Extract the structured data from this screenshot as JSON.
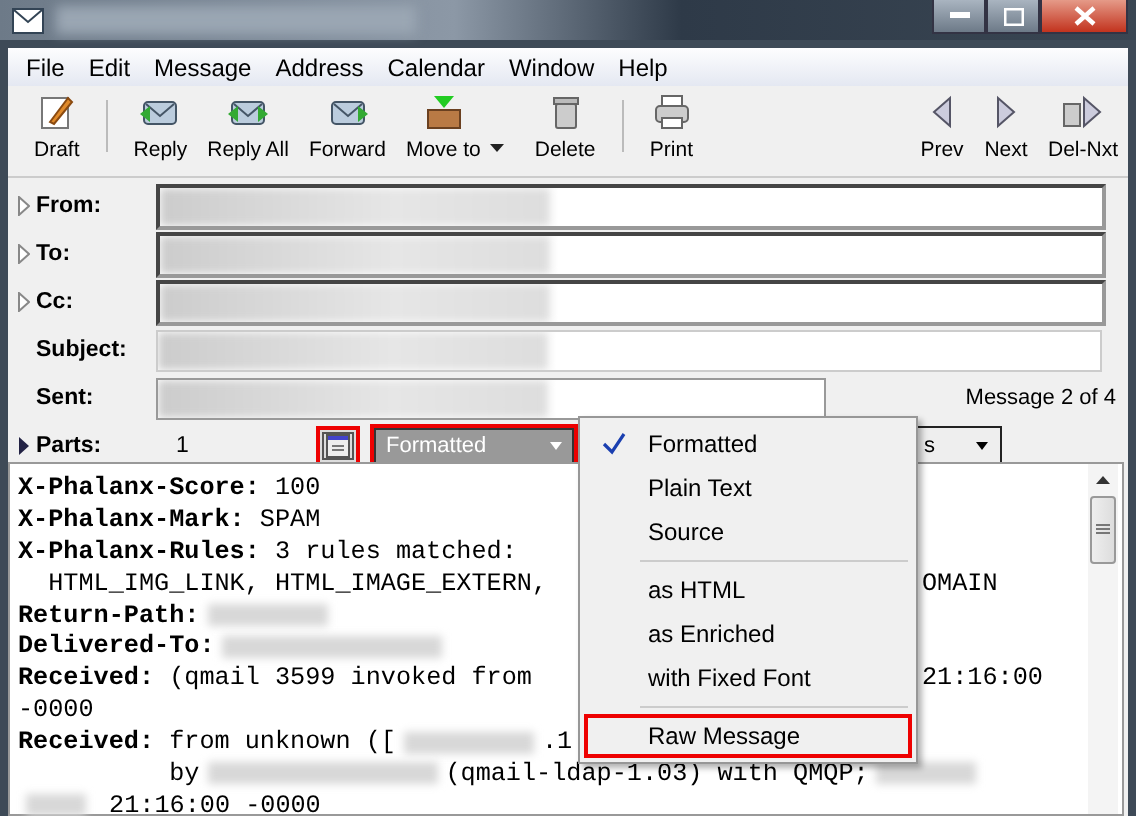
{
  "menu_bar": [
    "File",
    "Edit",
    "Message",
    "Address",
    "Calendar",
    "Window",
    "Help"
  ],
  "toolbar": [
    {
      "label": "Draft",
      "kind": "draft"
    },
    {
      "kind": "separator"
    },
    {
      "label": "Reply",
      "kind": "reply"
    },
    {
      "label": "Reply All",
      "kind": "replyall"
    },
    {
      "label": "Forward",
      "kind": "forward"
    },
    {
      "label": "Move to",
      "kind": "move"
    },
    {
      "label": "Delete",
      "kind": "delete"
    },
    {
      "kind": "separator"
    },
    {
      "label": "Print",
      "kind": "print"
    },
    {
      "kind": "spacer"
    },
    {
      "label": "Prev",
      "kind": "prev"
    },
    {
      "label": "Next",
      "kind": "next"
    },
    {
      "label": "Del-Nxt",
      "kind": "delnext"
    }
  ],
  "headers": [
    {
      "label": "From:",
      "expandable": true,
      "kind": "full"
    },
    {
      "label": "To:",
      "expandable": true,
      "kind": "full"
    },
    {
      "label": "Cc:",
      "expandable": true,
      "kind": "full"
    },
    {
      "label": "Subject:",
      "expandable": false,
      "kind": "flat"
    },
    {
      "label": "Sent:",
      "expandable": false,
      "kind": "short"
    }
  ],
  "message_position": "Message 2 of 4",
  "parts": {
    "label": "Parts:",
    "count": "1",
    "view_mode": "Formatted",
    "second_combo_visible": "s"
  },
  "body_lines": [
    [
      {
        "kind": "key",
        "text": "X-Phalanx-Score:"
      },
      {
        "kind": "text",
        "text": " 100"
      }
    ],
    [
      {
        "kind": "key",
        "text": "X-Phalanx-Mark:"
      },
      {
        "kind": "text",
        "text": " SPAM"
      }
    ],
    [
      {
        "kind": "key",
        "text": "X-Phalanx-Rules:"
      },
      {
        "kind": "text",
        "text": " 3 rules matched:"
      }
    ],
    [
      {
        "kind": "text",
        "text": "  HTML_IMG_LINK, HTML_IMAGE_EXTERN,"
      },
      {
        "kind": "right",
        "text": "OMAIN"
      }
    ],
    [
      {
        "kind": "key",
        "text": "Return-Path:"
      },
      {
        "kind": "blur"
      }
    ],
    [
      {
        "kind": "key",
        "text": "Delivered-To:"
      },
      {
        "kind": "blur"
      }
    ],
    [
      {
        "kind": "key",
        "text": "Received:"
      },
      {
        "kind": "text",
        "text": " (qmail 3599 invoked from"
      },
      {
        "kind": "right",
        "text": "21:16:00"
      }
    ],
    [
      {
        "kind": "text",
        "text": "-0000"
      }
    ],
    [
      {
        "kind": "key",
        "text": "Received:"
      },
      {
        "kind": "text",
        "text": " from unknown (["
      },
      {
        "kind": "blur"
      },
      {
        "kind": "text",
        "text": ".1"
      }
    ],
    [
      {
        "kind": "text",
        "text": "          by"
      },
      {
        "kind": "blur"
      },
      {
        "kind": "text",
        "text": "(qmail-ldap-1.03) with QMQP;"
      },
      {
        "kind": "blur"
      }
    ],
    [
      {
        "kind": "blur"
      },
      {
        "kind": "text",
        "text": " 21:16:00 -0000"
      }
    ]
  ],
  "view_menu": [
    {
      "kind": "item",
      "label": "Formatted",
      "checked": true,
      "highlighted": false
    },
    {
      "kind": "item",
      "label": "Plain Text",
      "checked": false,
      "highlighted": false
    },
    {
      "kind": "item",
      "label": "Source",
      "checked": false,
      "highlighted": false
    },
    {
      "kind": "separator"
    },
    {
      "kind": "item",
      "label": "as HTML",
      "checked": false,
      "highlighted": false
    },
    {
      "kind": "item",
      "label": "as Enriched",
      "checked": false,
      "highlighted": false
    },
    {
      "kind": "item",
      "label": "with Fixed Font",
      "checked": false,
      "highlighted": false
    },
    {
      "kind": "separator"
    },
    {
      "kind": "item",
      "label": "Raw Message",
      "checked": false,
      "highlighted": true
    }
  ]
}
